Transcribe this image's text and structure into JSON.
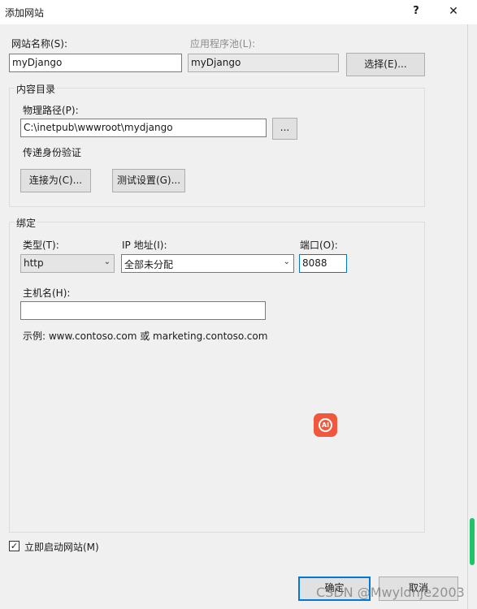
{
  "window": {
    "title": "添加网站",
    "help_label": "?",
    "close_label": "✕"
  },
  "site_name": {
    "label": "网站名称(S):",
    "value": "myDjango"
  },
  "app_pool": {
    "label": "应用程序池(L):",
    "value": "myDjango",
    "select_label": "选择(E)..."
  },
  "content_dir": {
    "group_label": "内容目录",
    "path_label": "物理路径(P):",
    "path_value": "C:\\inetpub\\wwwroot\\mydjango",
    "browse_label": "...",
    "pass_auth_label": "传递身份验证",
    "connect_as_label": "连接为(C)...",
    "test_settings_label": "测试设置(G)..."
  },
  "binding": {
    "group_label": "绑定",
    "type_label": "类型(T):",
    "type_value": "http",
    "ip_label": "IP 地址(I):",
    "ip_value": "全部未分配",
    "port_label": "端口(O):",
    "port_value": "8088",
    "host_label": "主机名(H):",
    "host_value": "",
    "example_text": "示例: www.contoso.com 或 marketing.contoso.com"
  },
  "start_immediately": {
    "label": "立即启动网站(M)",
    "checked": true,
    "check_glyph": "✓"
  },
  "footer": {
    "ok_label": "确定",
    "cancel_label": "取消"
  },
  "overlay": {
    "ai_badge_text": "AI",
    "watermark": "CSDN @Mwyldnje2003"
  },
  "colors": {
    "focus_blue": "#0078d7",
    "ai_badge": "#f1573c",
    "scroll_thumb": "#21c26a"
  }
}
